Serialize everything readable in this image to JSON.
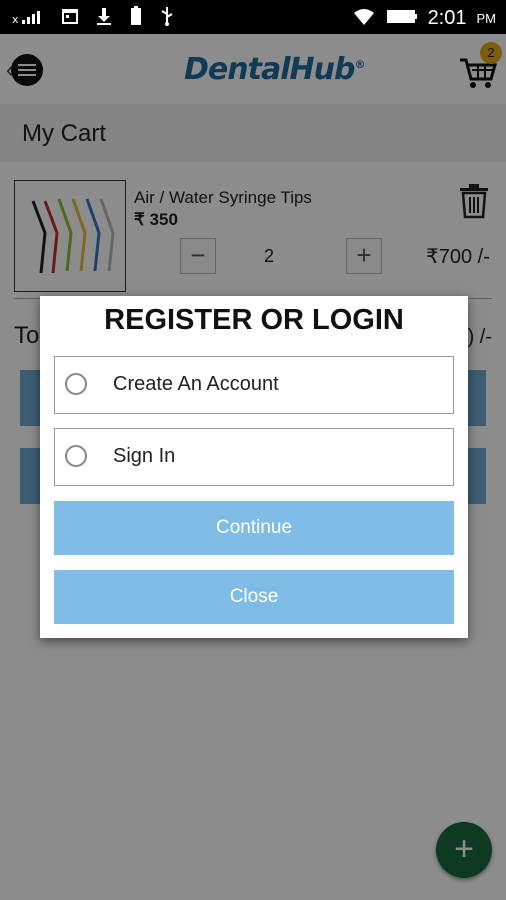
{
  "status_bar": {
    "time": "2:01",
    "ampm": "PM",
    "signal_text": "x"
  },
  "app_bar": {
    "logo_text_dental": "Dental",
    "logo_text_hub": "Hub",
    "logo_mark": "®",
    "cart_count": "2"
  },
  "page": {
    "title": "My Cart"
  },
  "cart": {
    "items": [
      {
        "name": "Air / Water Syringe Tips",
        "price": "₹ 350",
        "quantity": "2",
        "line_total": "₹700 /-"
      }
    ],
    "total_label": "To",
    "total_value": ") /-"
  },
  "dialog": {
    "title": "REGISTER OR LOGIN",
    "options": [
      {
        "label": "Create An Account",
        "selected": false
      },
      {
        "label": "Sign In",
        "selected": false
      }
    ],
    "continue_label": "Continue",
    "close_label": "Close"
  },
  "colors": {
    "brand": "#1f6a9e",
    "button": "#7fbde6",
    "fab": "#1a6b3c",
    "badge": "#e6a81a"
  }
}
